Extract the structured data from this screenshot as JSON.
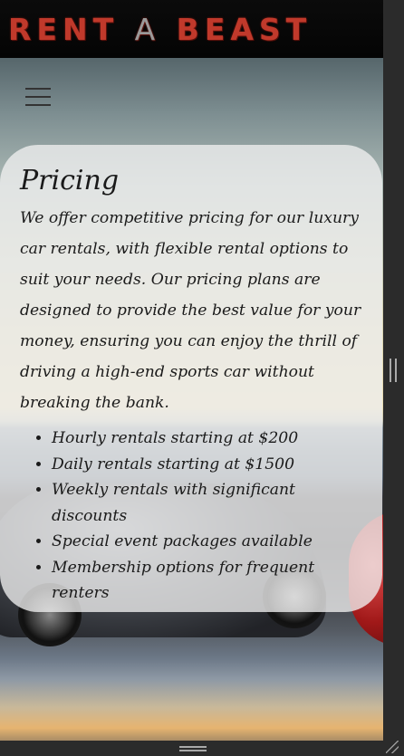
{
  "header": {
    "logo_part1": "RENT",
    "logo_part2": "A",
    "logo_part3": "BEAST"
  },
  "menu": {
    "icon": "hamburger-menu-icon"
  },
  "pricing": {
    "title": "Pricing",
    "description": "We offer competitive pricing for our luxury car rentals, with flexible rental options to suit your needs. Our pricing plans are designed to provide the best value for your money, ensuring you can enjoy the thrill of driving a high-end sports car without breaking the bank.",
    "items": [
      "Hourly rentals starting at $200",
      "Daily rentals starting at $1500",
      "Weekly rentals with significant discounts",
      "Special event packages available",
      "Membership options for frequent renters"
    ]
  },
  "colors": {
    "logo": "#c0392b",
    "header_bg": "#070707",
    "card_bg": "rgba(240,240,240,0.78)"
  }
}
